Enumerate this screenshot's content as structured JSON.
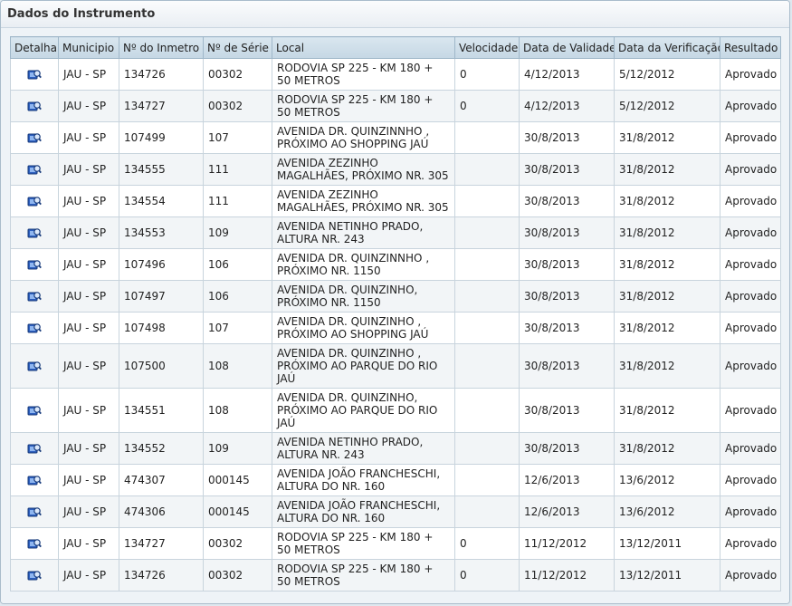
{
  "panel": {
    "title": "Dados do Instrumento"
  },
  "table": {
    "headers": [
      "Detalhar",
      "Municipio",
      "Nº do Inmetro",
      "Nº de Série",
      "Local",
      "Velocidade",
      "Data de Validade",
      "Data da Verificação",
      "Resultado"
    ],
    "rows": [
      {
        "municipio": "JAU - SP",
        "inmetro": "134726",
        "serie": "00302",
        "local": "RODOVIA SP 225 - KM 180 + 50 METROS",
        "velocidade": "0",
        "validade": "4/12/2013",
        "verificacao": "5/12/2012",
        "resultado": "Aprovado"
      },
      {
        "municipio": "JAU - SP",
        "inmetro": "134727",
        "serie": "00302",
        "local": "RODOVIA SP 225 - KM 180 + 50 METROS",
        "velocidade": "0",
        "validade": "4/12/2013",
        "verificacao": "5/12/2012",
        "resultado": "Aprovado"
      },
      {
        "municipio": "JAU - SP",
        "inmetro": "107499",
        "serie": "107",
        "local": "AVENIDA DR. QUINZINNHO , PRÓXIMO AO SHOPPING JAÚ",
        "velocidade": "",
        "validade": "30/8/2013",
        "verificacao": "31/8/2012",
        "resultado": "Aprovado"
      },
      {
        "municipio": "JAU - SP",
        "inmetro": "134555",
        "serie": "111",
        "local": "AVENIDA ZEZINHO MAGALHÃES, PRÓXIMO NR. 305",
        "velocidade": "",
        "validade": "30/8/2013",
        "verificacao": "31/8/2012",
        "resultado": "Aprovado"
      },
      {
        "municipio": "JAU - SP",
        "inmetro": "134554",
        "serie": "111",
        "local": "AVENIDA ZEZINHO MAGALHÃES, PRÓXIMO NR. 305",
        "velocidade": "",
        "validade": "30/8/2013",
        "verificacao": "31/8/2012",
        "resultado": "Aprovado"
      },
      {
        "municipio": "JAU - SP",
        "inmetro": "134553",
        "serie": "109",
        "local": "AVENIDA NETINHO PRADO, ALTURA NR. 243",
        "velocidade": "",
        "validade": "30/8/2013",
        "verificacao": "31/8/2012",
        "resultado": "Aprovado"
      },
      {
        "municipio": "JAU - SP",
        "inmetro": "107496",
        "serie": "106",
        "local": "AVENIDA DR. QUINZINNHO , PRÓXIMO NR. 1150",
        "velocidade": "",
        "validade": "30/8/2013",
        "verificacao": "31/8/2012",
        "resultado": "Aprovado"
      },
      {
        "municipio": "JAU - SP",
        "inmetro": "107497",
        "serie": "106",
        "local": "AVENIDA DR. QUINZINHO, PRÓXIMO NR. 1150",
        "velocidade": "",
        "validade": "30/8/2013",
        "verificacao": "31/8/2012",
        "resultado": "Aprovado"
      },
      {
        "municipio": "JAU - SP",
        "inmetro": "107498",
        "serie": "107",
        "local": "AVENIDA DR. QUINZINHO , PRÓXIMO AO SHOPPING JAÚ",
        "velocidade": "",
        "validade": "30/8/2013",
        "verificacao": "31/8/2012",
        "resultado": "Aprovado"
      },
      {
        "municipio": "JAU - SP",
        "inmetro": "107500",
        "serie": "108",
        "local": "AVENIDA DR. QUINZINHO , PRÓXIMO AO PARQUE DO RIO JAÚ",
        "velocidade": "",
        "validade": "30/8/2013",
        "verificacao": "31/8/2012",
        "resultado": "Aprovado"
      },
      {
        "municipio": "JAU - SP",
        "inmetro": "134551",
        "serie": "108",
        "local": "AVENIDA DR. QUINZINHO, PRÓXIMO AO PARQUE DO RIO JAÚ",
        "velocidade": "",
        "validade": "30/8/2013",
        "verificacao": "31/8/2012",
        "resultado": "Aprovado"
      },
      {
        "municipio": "JAU - SP",
        "inmetro": "134552",
        "serie": "109",
        "local": "AVENIDA NETINHO PRADO, ALTURA NR. 243",
        "velocidade": "",
        "validade": "30/8/2013",
        "verificacao": "31/8/2012",
        "resultado": "Aprovado"
      },
      {
        "municipio": "JAU - SP",
        "inmetro": "474307",
        "serie": "000145",
        "local": "AVENIDA JOÃO FRANCHESCHI, ALTURA DO NR. 160",
        "velocidade": "",
        "validade": "12/6/2013",
        "verificacao": "13/6/2012",
        "resultado": "Aprovado"
      },
      {
        "municipio": "JAU - SP",
        "inmetro": "474306",
        "serie": "000145",
        "local": "AVENIDA JOÃO FRANCHESCHI, ALTURA DO NR. 160",
        "velocidade": "",
        "validade": "12/6/2013",
        "verificacao": "13/6/2012",
        "resultado": "Aprovado"
      },
      {
        "municipio": "JAU - SP",
        "inmetro": "134727",
        "serie": "00302",
        "local": "RODOVIA SP 225 - KM 180 + 50 METROS",
        "velocidade": "0",
        "validade": "11/12/2012",
        "verificacao": "13/12/2011",
        "resultado": "Aprovado"
      },
      {
        "municipio": "JAU - SP",
        "inmetro": "134726",
        "serie": "00302",
        "local": "RODOVIA SP 225 - KM 180 + 50 METROS",
        "velocidade": "0",
        "validade": "11/12/2012",
        "verificacao": "13/12/2011",
        "resultado": "Aprovado"
      }
    ]
  },
  "icons": {
    "detail": "detail-magnifier-icon"
  },
  "colors": {
    "header_bg": "#c5d7e4",
    "row_alt": "#f2f5f7",
    "icon_blue": "#1f4fa8"
  }
}
